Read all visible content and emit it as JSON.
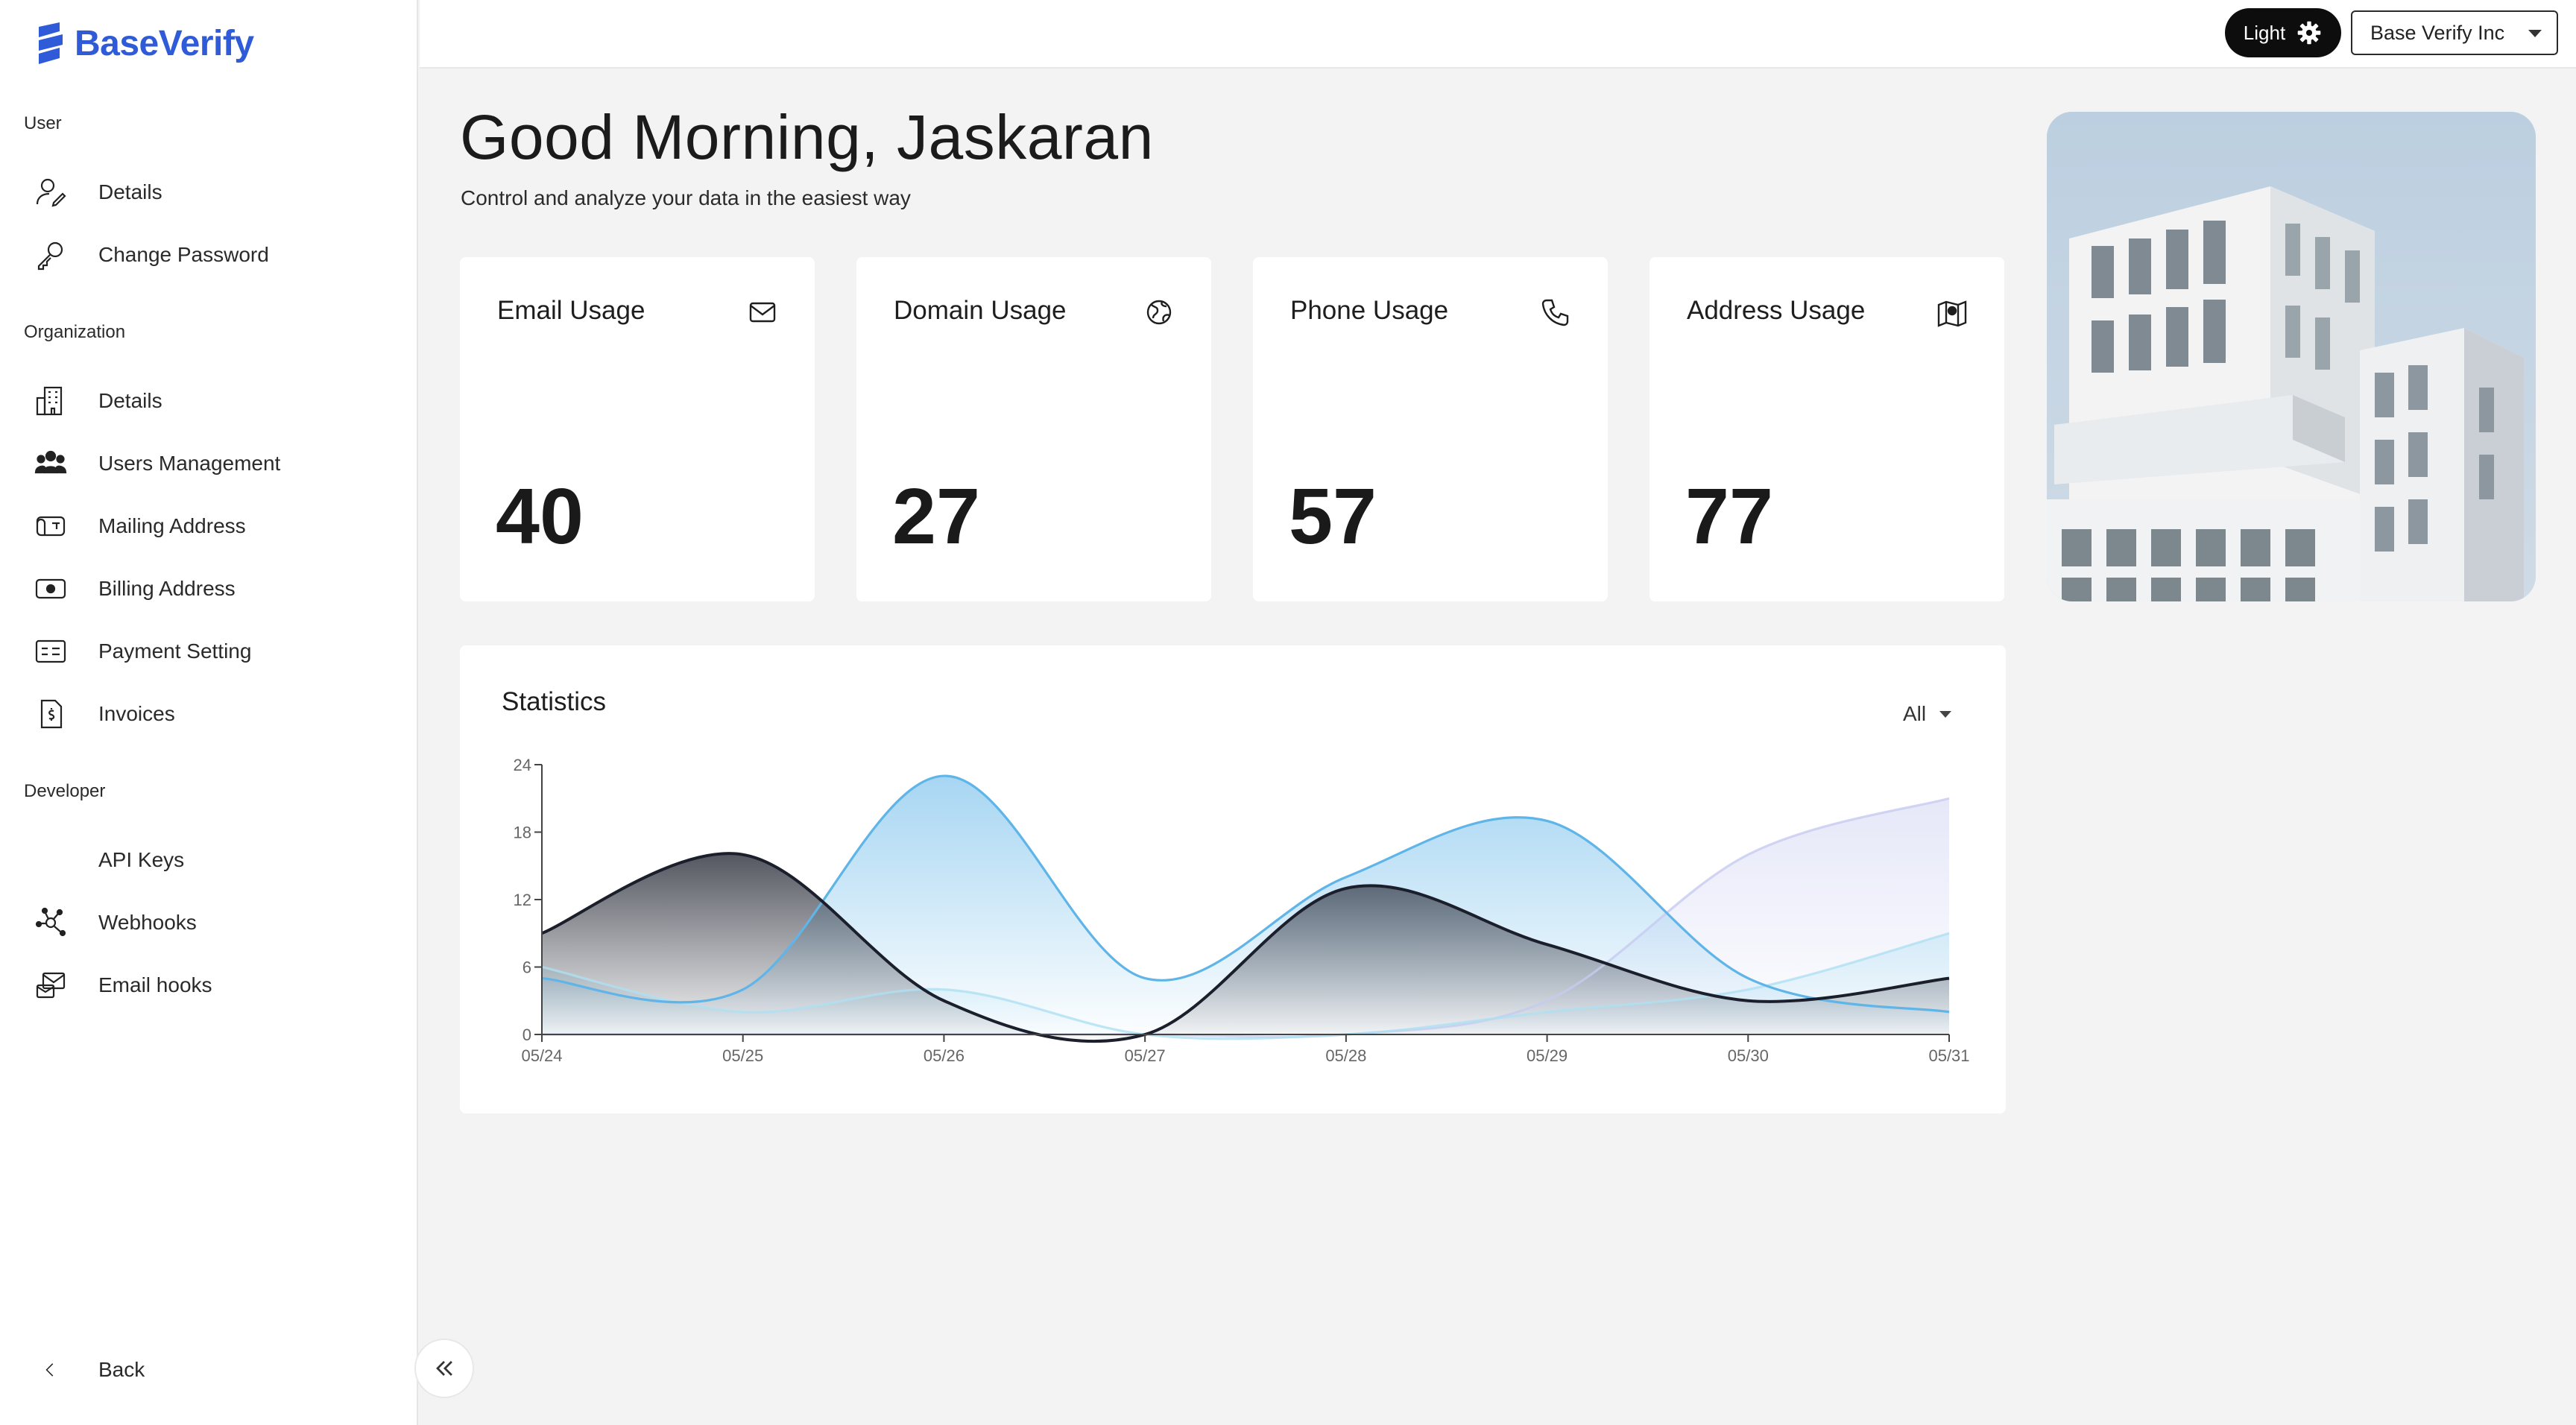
{
  "brand": {
    "name": "BaseVerify",
    "color": "#2f5bd8"
  },
  "sidebar": {
    "sections": [
      {
        "label": "User",
        "items": [
          {
            "label": "Details",
            "icon": "user-edit-icon"
          },
          {
            "label": "Change Password",
            "icon": "key-icon"
          }
        ]
      },
      {
        "label": "Organization",
        "items": [
          {
            "label": "Details",
            "icon": "building-icon"
          },
          {
            "label": "Users Management",
            "icon": "users-icon"
          },
          {
            "label": "Mailing Address",
            "icon": "mailbox-icon"
          },
          {
            "label": "Billing Address",
            "icon": "cash-icon"
          },
          {
            "label": "Payment Setting",
            "icon": "card-icon"
          },
          {
            "label": "Invoices",
            "icon": "invoice-icon"
          }
        ]
      },
      {
        "label": "Developer",
        "items": [
          {
            "label": "API Keys",
            "icon": ""
          },
          {
            "label": "Webhooks",
            "icon": "webhook-icon"
          },
          {
            "label": "Email hooks",
            "icon": "email-hook-icon"
          }
        ]
      }
    ],
    "back_label": "Back"
  },
  "topbar": {
    "theme_label": "Light",
    "org_name": "Base Verify Inc"
  },
  "greeting": {
    "title": "Good Morning, Jaskaran",
    "subtitle": "Control and analyze your data in the easiest way"
  },
  "cards": [
    {
      "title": "Email Usage",
      "value": "40",
      "icon": "envelope-icon"
    },
    {
      "title": "Domain Usage",
      "value": "27",
      "icon": "globe-icon"
    },
    {
      "title": "Phone Usage",
      "value": "57",
      "icon": "phone-icon"
    },
    {
      "title": "Address Usage",
      "value": "77",
      "icon": "map-pin-icon"
    }
  ],
  "stats": {
    "title": "Statistics",
    "filter_value": "All"
  },
  "chart_data": {
    "type": "area",
    "x": [
      "05/24",
      "05/25",
      "05/26",
      "05/27",
      "05/28",
      "05/29",
      "05/30",
      "05/31"
    ],
    "ylim": [
      0,
      24
    ],
    "yticks": [
      0,
      6,
      12,
      18,
      24
    ],
    "series": [
      {
        "color": "#1b1e2b",
        "values": [
          9,
          16,
          3,
          0,
          13,
          8,
          3,
          5
        ]
      },
      {
        "color": "#5fb4e8",
        "values": [
          5,
          4,
          23,
          5,
          14,
          19,
          5,
          2
        ]
      },
      {
        "color": "#aee0f3",
        "values": [
          6,
          2,
          4,
          0,
          0,
          2,
          4,
          9
        ]
      },
      {
        "color": "#c7cbf0",
        "values": [
          0,
          0,
          0,
          0,
          0,
          3,
          16,
          21
        ]
      }
    ],
    "grid": false
  }
}
